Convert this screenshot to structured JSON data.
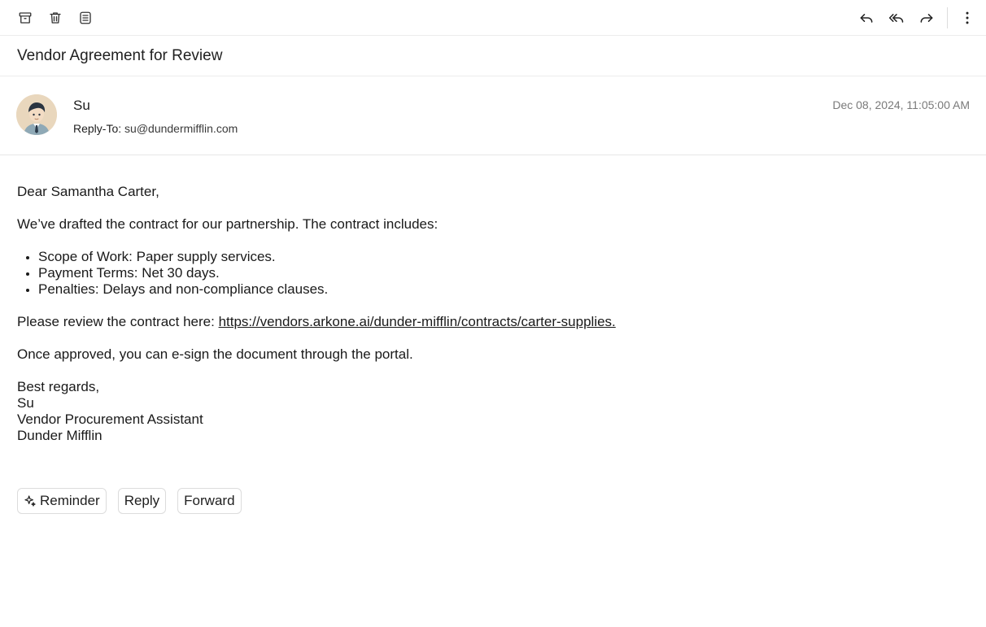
{
  "toolbar": {
    "left_icons": [
      "archive-icon",
      "trash-icon",
      "list-icon"
    ],
    "right_icons": [
      "reply-icon",
      "reply-all-icon",
      "forward-icon",
      "more-vertical-icon"
    ]
  },
  "email": {
    "subject": "Vendor Agreement for Review",
    "sender_name": "Su",
    "reply_to_label": "Reply-To:",
    "reply_to_address": "su@dundermifflin.com",
    "date": "Dec 08, 2024, 11:05:00 AM",
    "greeting": "Dear Samantha Carter,",
    "intro": "We’ve drafted the contract for our partnership. The contract includes:",
    "bullets": [
      "Scope of Work: Paper supply services.",
      "Payment Terms: Net 30 days.",
      "Penalties: Delays and non-compliance clauses."
    ],
    "review_text": "Please review the contract here: ",
    "review_link": "https://vendors.arkone.ai/dunder-mifflin/contracts/carter-supplies.",
    "approval_text": "Once approved, you can e-sign the document through the portal.",
    "signoff": "Best regards,",
    "signature_name": "Su",
    "signature_title": "Vendor Procurement Assistant",
    "signature_company": "Dunder Mifflin"
  },
  "actions": {
    "reminder": "Reminder",
    "reply": "Reply",
    "forward": "Forward"
  }
}
